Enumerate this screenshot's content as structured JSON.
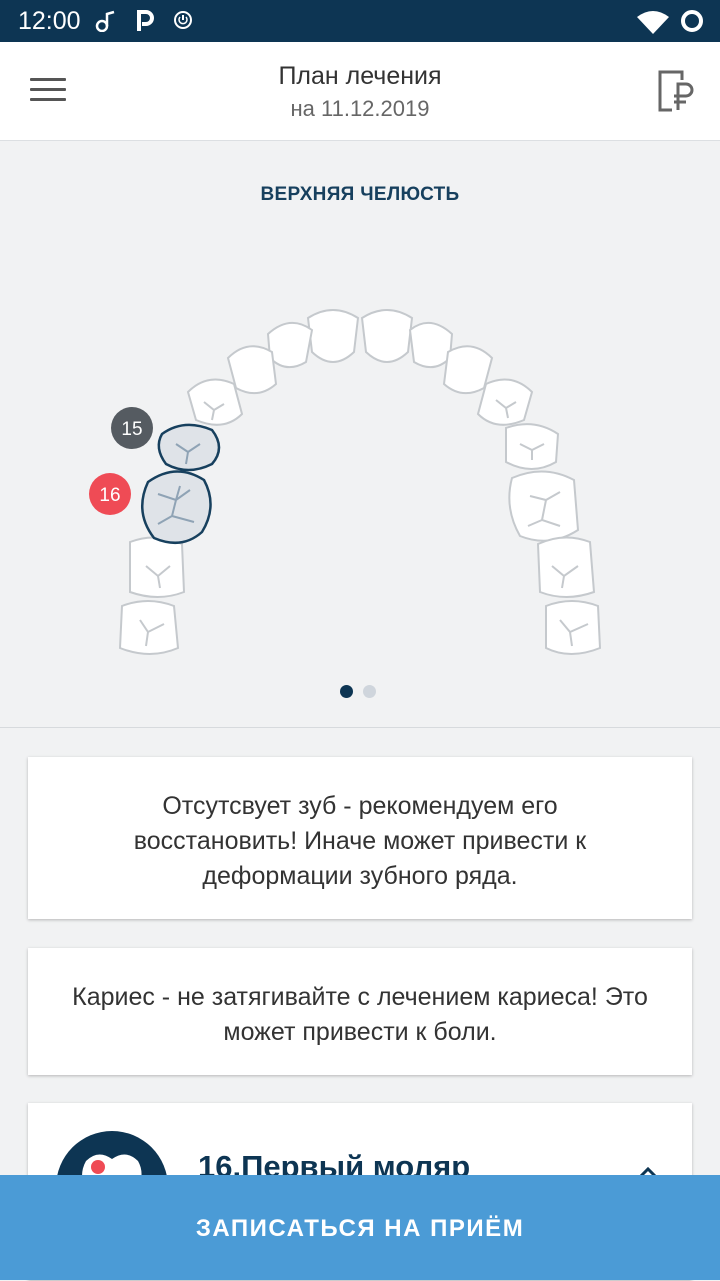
{
  "status_bar": {
    "time": "12:00"
  },
  "header": {
    "title": "План лечения",
    "subtitle": "на 11.12.2019"
  },
  "jaw": {
    "title": "ВЕРХНЯЯ ЧЕЛЮСТЬ",
    "markers": [
      {
        "label": "15",
        "color": "#555b61"
      },
      {
        "label": "16",
        "color": "#ef4b55"
      }
    ],
    "pager": {
      "pages": 2,
      "active": 0
    }
  },
  "cards": [
    {
      "text": "Отсутсвует зуб - рекомендуем его восстановить! Иначе может привести к деформации зубного ряда."
    },
    {
      "text": "Кариес - не затягивайте с лечением кариеса! Это может привести к боли."
    }
  ],
  "tooth_card": {
    "name": "16.Первый моляр"
  },
  "cta": {
    "label": "ЗАПИСАТЬСЯ НА ПРИЁМ"
  },
  "colors": {
    "status_bar": "#0d3553",
    "accent": "#4b9bd6",
    "selected_tooth": "#17405e",
    "caries_marker": "#ef4b55"
  }
}
